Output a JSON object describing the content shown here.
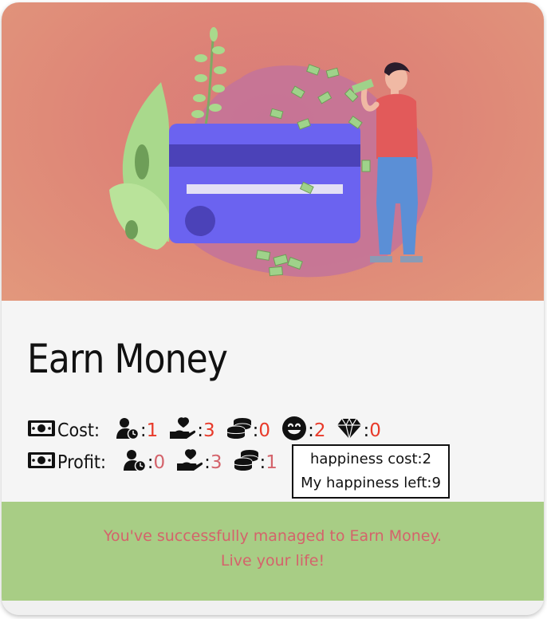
{
  "card": {
    "title": "Earn Money",
    "cost": {
      "label": "Cost:",
      "items": [
        {
          "icon": "person-clock-icon",
          "value": "1"
        },
        {
          "icon": "hand-heart-icon",
          "value": "3"
        },
        {
          "icon": "coins-icon",
          "value": "0"
        },
        {
          "icon": "smiley-icon",
          "value": "2"
        },
        {
          "icon": "diamond-icon",
          "value": "0"
        }
      ]
    },
    "profit": {
      "label": "Profit:",
      "items": [
        {
          "icon": "person-clock-icon",
          "value": "0"
        },
        {
          "icon": "hand-heart-icon",
          "value": "3"
        },
        {
          "icon": "coins-icon",
          "value": "1"
        }
      ]
    },
    "tooltip": {
      "line1": "happiness cost:2",
      "line2": "My happiness left:9"
    },
    "footer": {
      "line1": "You've successfully managed to Earn Money.",
      "line2": "Live your life!"
    }
  },
  "colors": {
    "hero_bg": "#de8577",
    "card_bg": "#f5f5f5",
    "footer_bg": "#a8cd85",
    "footer_text": "#d4636b",
    "cost_value": "#e83a2a",
    "profit_value": "#d4636b"
  }
}
